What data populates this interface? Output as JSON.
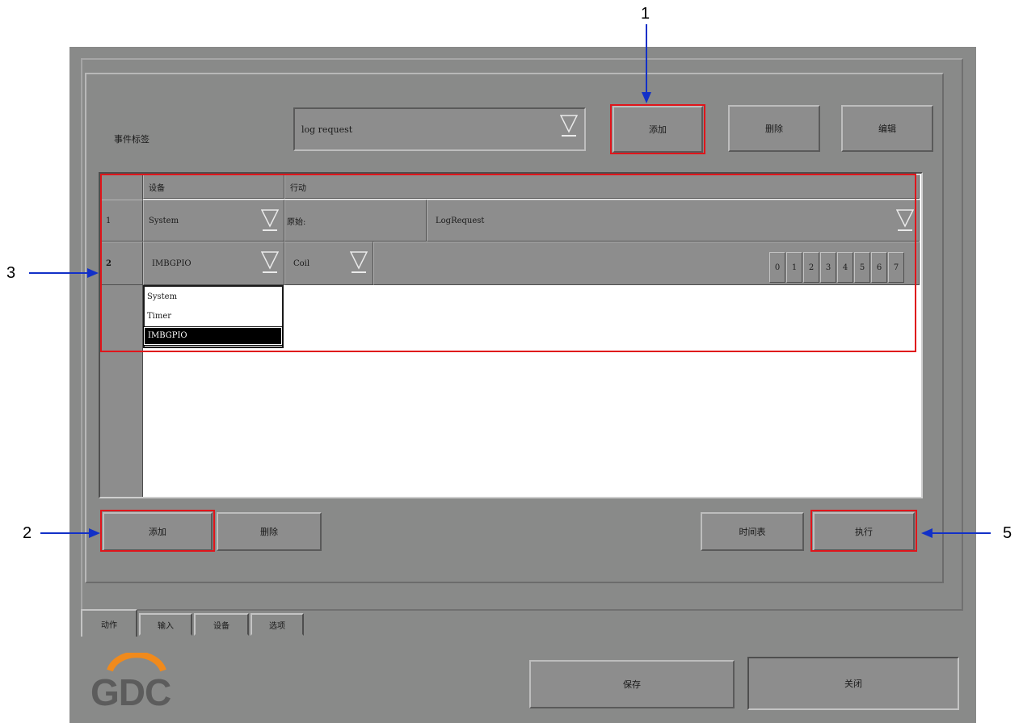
{
  "event_label": "事件标签",
  "event_dropdown_value": "log request",
  "top_buttons": {
    "add": "添加",
    "delete": "删除",
    "edit": "编辑"
  },
  "table": {
    "columns": [
      "设备",
      "行动"
    ],
    "row1": {
      "num": "1",
      "device": "System",
      "action_label": "原始:",
      "action_value": "LogRequest"
    },
    "row2": {
      "num": "2",
      "device": "IMBGPIO",
      "action": "Coil",
      "bits": [
        "0",
        "1",
        "2",
        "3",
        "4",
        "5",
        "6",
        "7"
      ]
    },
    "device_options": [
      "System",
      "Timer",
      "IMBGPIO"
    ],
    "selected_option": "IMBGPIO"
  },
  "bottom_buttons": {
    "add": "添加",
    "delete": "删除",
    "schedule": "时间表",
    "execute": "执行"
  },
  "tabs": [
    "动作",
    "输入",
    "设备",
    "选项"
  ],
  "footer_buttons": {
    "save": "保存",
    "close": "关闭"
  },
  "logo_text": "GDC",
  "callouts": [
    "1",
    "2",
    "3",
    "5"
  ],
  "colors": {
    "callout_arrow": "#1230c8",
    "highlight": "#e0151b",
    "logo_orange": "#f08a1c",
    "logo_gray": "#5c5c5c"
  }
}
